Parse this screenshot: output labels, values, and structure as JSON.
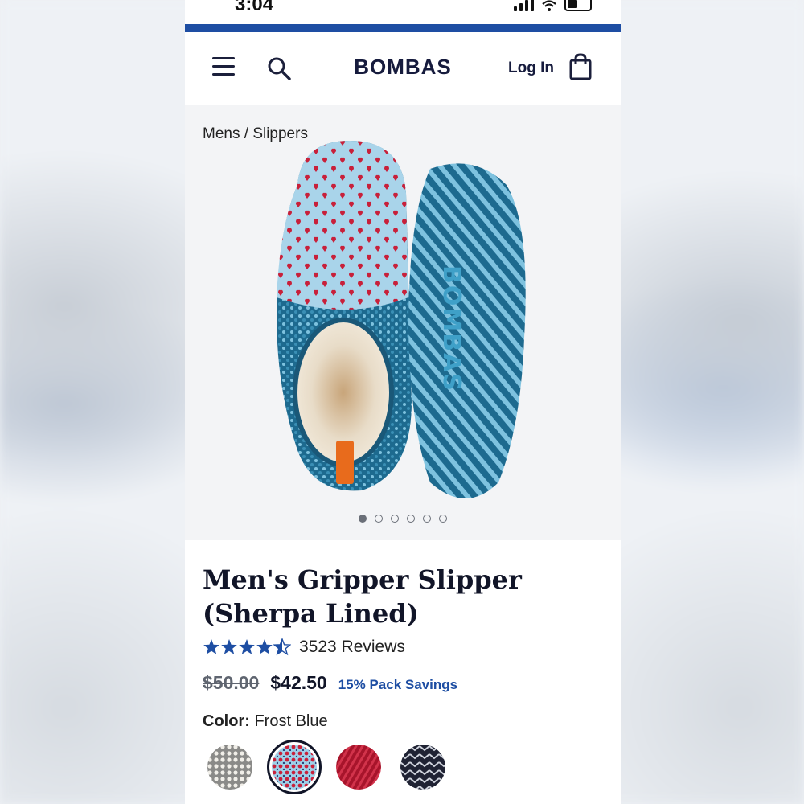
{
  "status_bar": {
    "time": "3:04"
  },
  "header": {
    "brand": "BOMBAS",
    "login_label": "Log In"
  },
  "breadcrumb": {
    "parent": "Mens",
    "separator": " / ",
    "current": "Slippers"
  },
  "gallery": {
    "image_count": 6,
    "active_index": 0,
    "sole_text": "BOMBAS"
  },
  "product": {
    "title": "Men's Gripper Slipper (Sherpa Lined)",
    "rating": 4.5,
    "reviews_label": "3523 Reviews",
    "old_price": "$50.00",
    "price": "$42.50",
    "savings_label": "15% Pack Savings",
    "color_label": "Color:",
    "color_value": "Frost Blue",
    "swatches": [
      {
        "name": "gray-white",
        "selected": false
      },
      {
        "name": "frost-blue",
        "selected": true
      },
      {
        "name": "red",
        "selected": false
      },
      {
        "name": "navy-chevron",
        "selected": false
      }
    ]
  },
  "colors": {
    "brand_blue": "#1e4ea3",
    "text_dark": "#111528",
    "star": "#1e4ea3"
  }
}
